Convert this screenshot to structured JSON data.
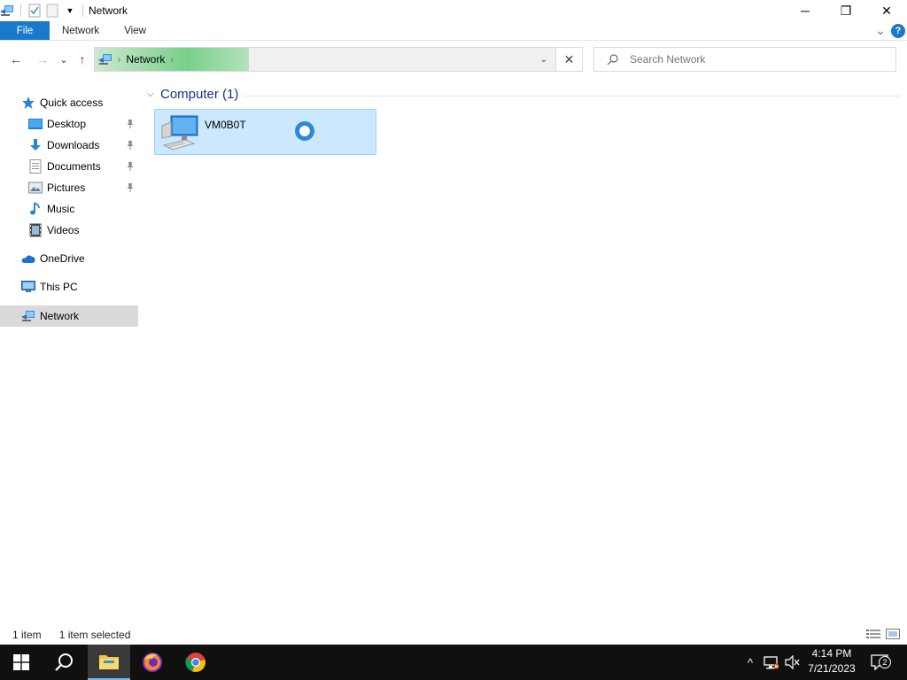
{
  "window": {
    "title": "Network",
    "minimize_glyph": "─",
    "restore_glyph": "❐",
    "close_glyph": "✕"
  },
  "ribbon": {
    "tabs": [
      {
        "label": "File",
        "name": "tab-file"
      },
      {
        "label": "Network",
        "name": "tab-network"
      },
      {
        "label": "View",
        "name": "tab-view"
      }
    ],
    "expand_glyph": "⌄",
    "help_glyph": "?"
  },
  "navigation": {
    "back_glyph": "←",
    "forward_glyph": "→",
    "recent_glyph": "⌄",
    "up_glyph": "↑"
  },
  "address": {
    "crumbs": [
      "Network"
    ],
    "separator": "›",
    "dropdown_glyph": "⌄",
    "clear_glyph": "✕"
  },
  "search": {
    "placeholder": "Search Network"
  },
  "sidebar": {
    "items": [
      {
        "label": "Quick access",
        "icon": "star-icon"
      },
      {
        "label": "Desktop",
        "icon": "desktop-icon",
        "pinned": true
      },
      {
        "label": "Downloads",
        "icon": "download-icon",
        "pinned": true
      },
      {
        "label": "Documents",
        "icon": "documents-icon",
        "pinned": true
      },
      {
        "label": "Pictures",
        "icon": "pictures-icon",
        "pinned": true
      },
      {
        "label": "Music",
        "icon": "music-icon"
      },
      {
        "label": "Videos",
        "icon": "videos-icon"
      },
      {
        "label": "OneDrive",
        "icon": "cloud-icon"
      },
      {
        "label": "This PC",
        "icon": "computer-icon"
      },
      {
        "label": "Network",
        "icon": "network-icon",
        "selected": true
      }
    ]
  },
  "content": {
    "group": {
      "chevron": "⌵",
      "title": "Computer (1)"
    },
    "items": [
      {
        "name": "VM0B0T"
      }
    ]
  },
  "status": {
    "count": "1 item",
    "selection": "1 item selected"
  },
  "taskbar": {
    "clock_time": "4:14 PM",
    "clock_date": "7/21/2023",
    "notifications_count": "2",
    "tray_up_glyph": "^"
  },
  "colors": {
    "accent": "#1979ca",
    "selection": "#cce8ff",
    "taskbar": "#101010"
  }
}
